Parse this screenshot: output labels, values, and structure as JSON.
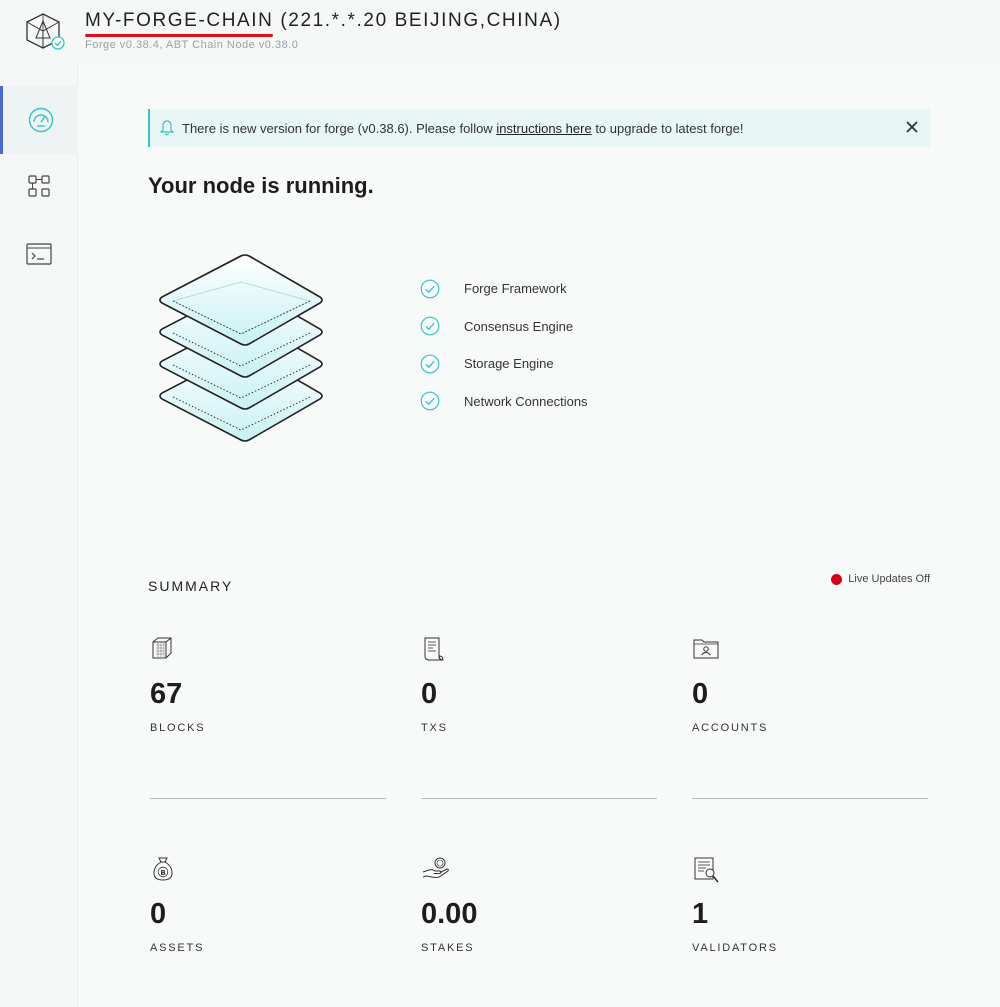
{
  "header": {
    "chain_name": "MY-FORGE-CHAIN",
    "location": " (221.*.*.20 BEIJING,CHINA)",
    "version": "Forge v0.38.4, ABT Chain Node v0.38.0"
  },
  "sidebar": {
    "items": [
      {
        "name": "dashboard",
        "icon": "speedometer-icon",
        "active": true
      },
      {
        "name": "blocks",
        "icon": "apps-grid-icon",
        "active": false
      },
      {
        "name": "console",
        "icon": "terminal-icon",
        "active": false
      }
    ]
  },
  "banner": {
    "text_before": "There is new version for forge (v0.38.6). Please follow ",
    "link": "instructions here",
    "text_after": " to upgrade to latest forge!",
    "icon": "bell-icon",
    "close_icon": "close-icon"
  },
  "status": {
    "heading": "Your node is running.",
    "components": [
      "Forge Framework",
      "Consensus Engine",
      "Storage Engine",
      "Network Connections"
    ],
    "check_color": "#35c2c9"
  },
  "summary": {
    "title": "SUMMARY",
    "live_label": "Live Updates Off",
    "live_color": "#d0021b",
    "stats": [
      {
        "value": "67",
        "label": "BLOCKS",
        "icon": "cube-icon"
      },
      {
        "value": "0",
        "label": "TXS",
        "icon": "receipt-icon"
      },
      {
        "value": "0",
        "label": "ACCOUNTS",
        "icon": "folder-user-icon"
      },
      {
        "value": "0",
        "label": "ASSETS",
        "icon": "money-bag-icon"
      },
      {
        "value": "0.00",
        "label": "STAKES",
        "icon": "coin-hand-icon"
      },
      {
        "value": "1",
        "label": "VALIDATORS",
        "icon": "document-check-icon"
      }
    ]
  }
}
